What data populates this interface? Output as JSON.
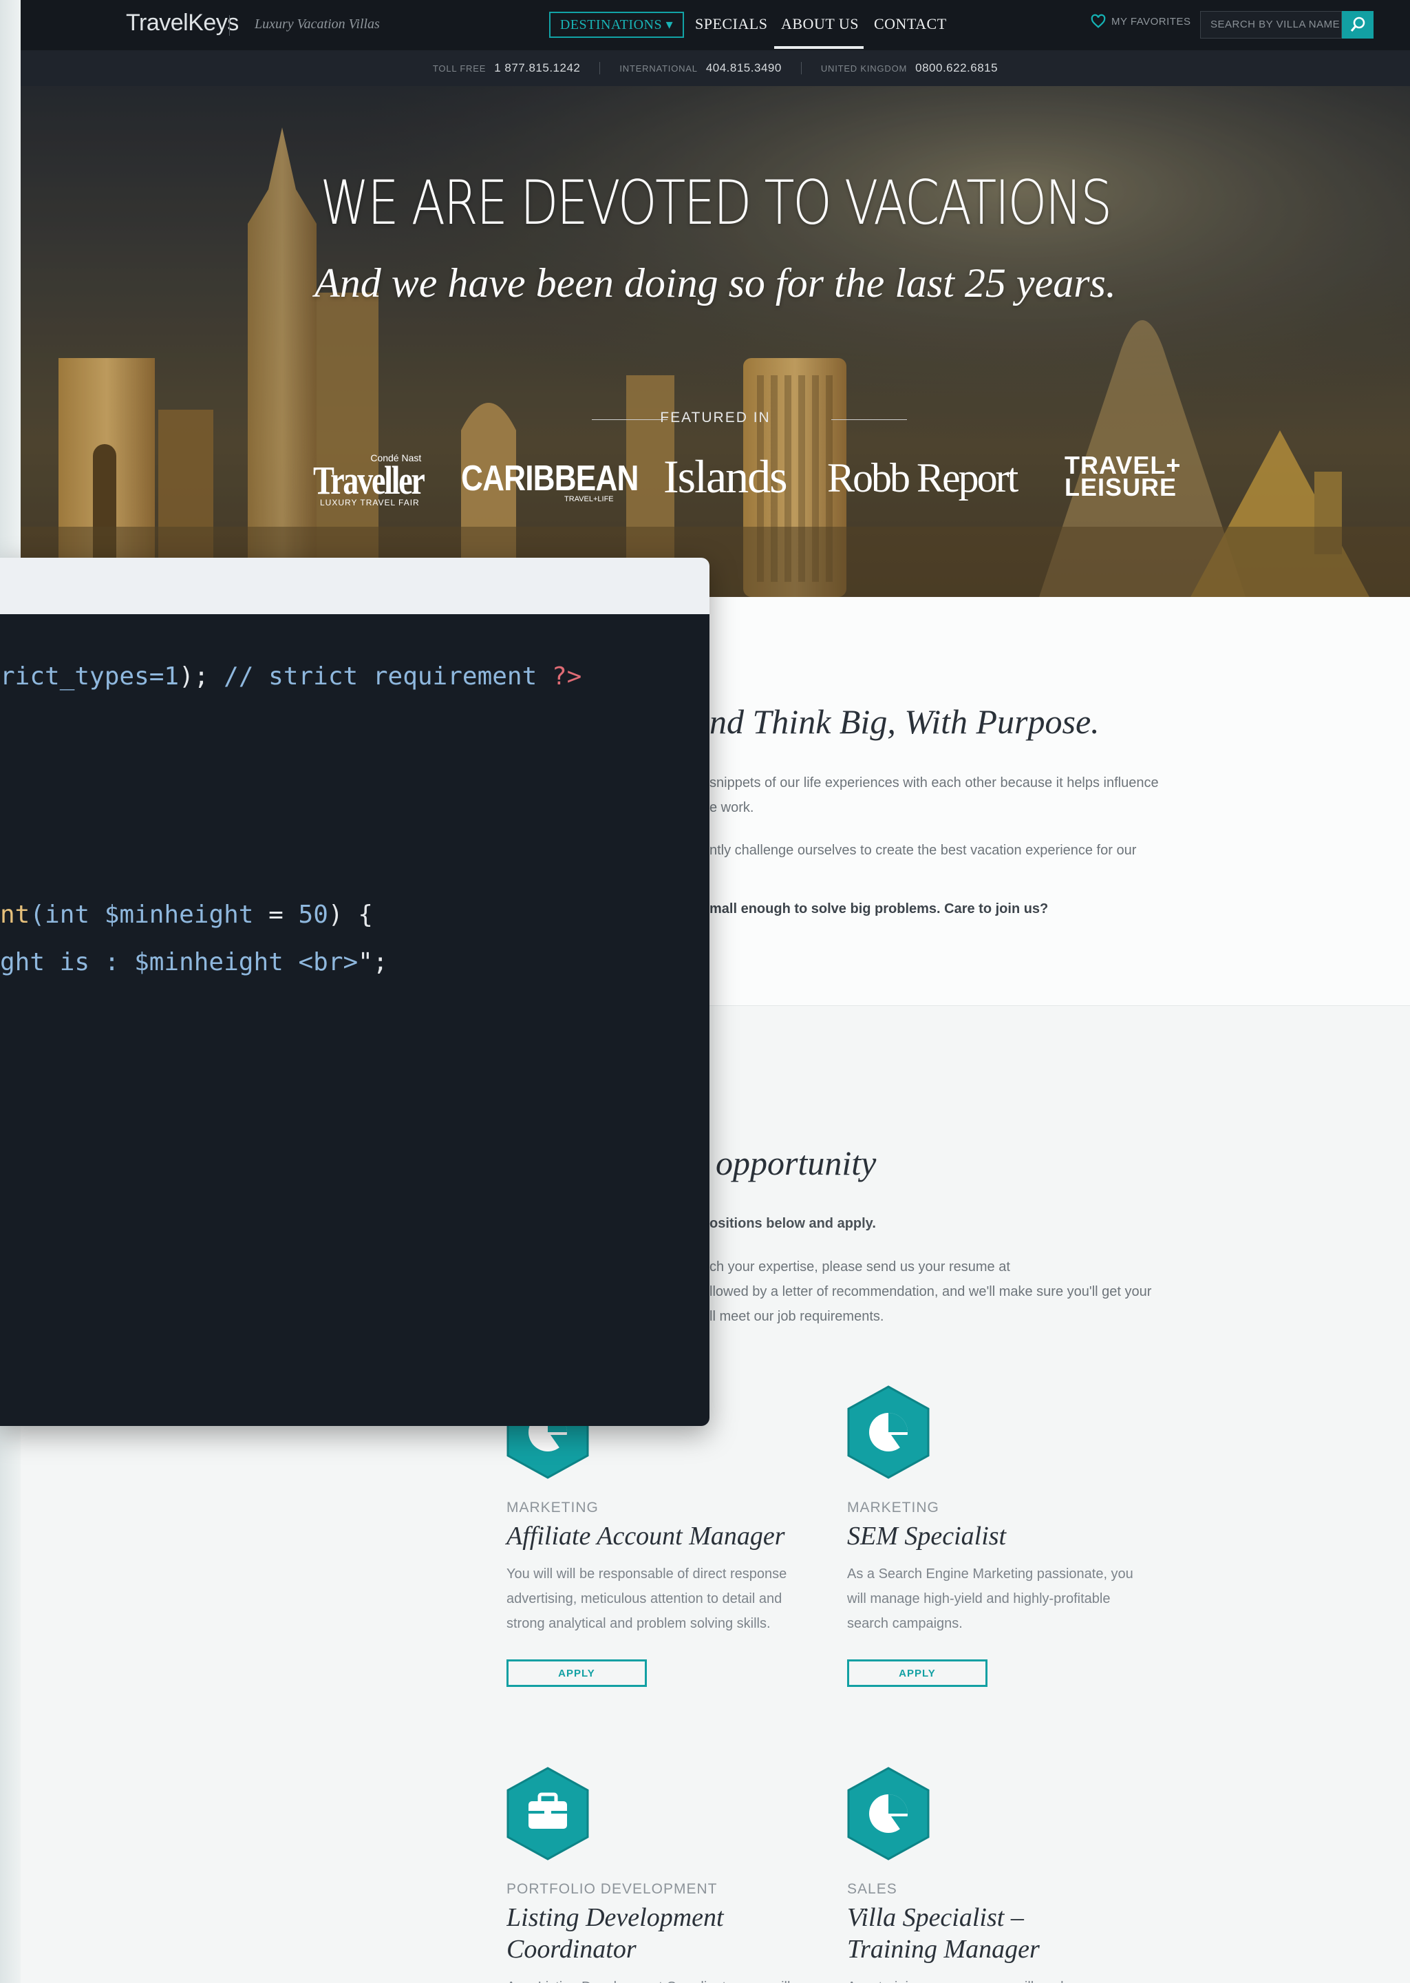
{
  "brand": {
    "logo": "TravelKeys",
    "tagline": "Luxury Vacation Villas"
  },
  "nav": {
    "items": [
      {
        "label": "DESTINATIONS ▾"
      },
      {
        "label": "SPECIALS"
      },
      {
        "label": "ABOUT US"
      },
      {
        "label": "CONTACT"
      }
    ],
    "favorites": "MY FAVORITES",
    "search_placeholder": "SEARCH BY VILLA NAME"
  },
  "phones": [
    {
      "label": "TOLL FREE",
      "number": "1 877.815.1242"
    },
    {
      "label": "INTERNATIONAL",
      "number": "404.815.3490"
    },
    {
      "label": "UNITED KINGDOM",
      "number": "0800.622.6815"
    }
  ],
  "hero": {
    "title": "WE ARE DEVOTED TO VACATIONS",
    "subtitle": "And we have been doing so for the last 25 years.",
    "featured_label": "FEATURED IN",
    "publications": [
      {
        "name": "Traveller",
        "sub": "LUXURY TRAVEL FAIR",
        "pre": "Condé Nast"
      },
      {
        "name": "CARIBBEAN",
        "sub": "TRAVEL+LIFE"
      },
      {
        "name": "Islands"
      },
      {
        "name": "Robb Report"
      },
      {
        "name": "TRAVEL+",
        "name2": "LEISURE"
      }
    ]
  },
  "code": {
    "line1": {
      "a": "rict_types=1",
      "b": "); ",
      "c": "// strict requirement ",
      "d": "?>"
    },
    "line2": {
      "a": "nt",
      "b": "(int ",
      "c": "$minheight",
      "d": " = ",
      "e": "50",
      "f": ") {"
    },
    "line3": {
      "a": "ght is : $minheight <br>",
      "b": "\";"
    }
  },
  "about": {
    "title": "nd Think Big, With Purpose.",
    "p1_l1": "snippets of our life experiences with each other because it helps influence",
    "p1_l2": "e work.",
    "p2_l1": "ntly challenge ourselves to create the best vacation experience for our",
    "bold": "mall enough to solve big problems. Care to join us?"
  },
  "careers": {
    "title": "opportunity",
    "bold": "ositions below and apply.",
    "p_l1": "ch your expertise, please send us your resume at",
    "p_l2": "llowed by a letter of recommendation, and we'll make sure you'll get your",
    "p_l3": "ll meet our job requirements.",
    "jobs": [
      {
        "category": "MARKETING",
        "title": "Affiliate Account Manager",
        "desc": [
          "You will will be responsable of direct response",
          "advertising, meticulous attention to detail and",
          "strong analytical and problem solving skills."
        ],
        "apply": "APPLY",
        "icon": "pie-chart-icon"
      },
      {
        "category": "MARKETING",
        "title": "SEM Specialist",
        "desc": [
          "As a Search Engine Marketing passionate, you",
          "will manage high-yield and highly-profitable",
          "search campaigns."
        ],
        "apply": "APPLY",
        "icon": "pie-chart-icon"
      },
      {
        "category": "PORTFOLIO DEVELOPMENT",
        "title_l1": "Listing Development",
        "title_l2": "Coordinator",
        "desc": [
          "As a Listing Development Coordinator, you will"
        ],
        "icon": "briefcase-icon"
      },
      {
        "category": "SALES",
        "title_l1": "Villa Specialist –",
        "title_l2": "Training Manager",
        "desc": [
          "As a training manager, you will analyze"
        ],
        "icon": "pie-chart-icon"
      }
    ]
  },
  "colors": {
    "accent": "#12a0a3",
    "nav_bg": "#14181e",
    "code_bg": "#161c24"
  }
}
